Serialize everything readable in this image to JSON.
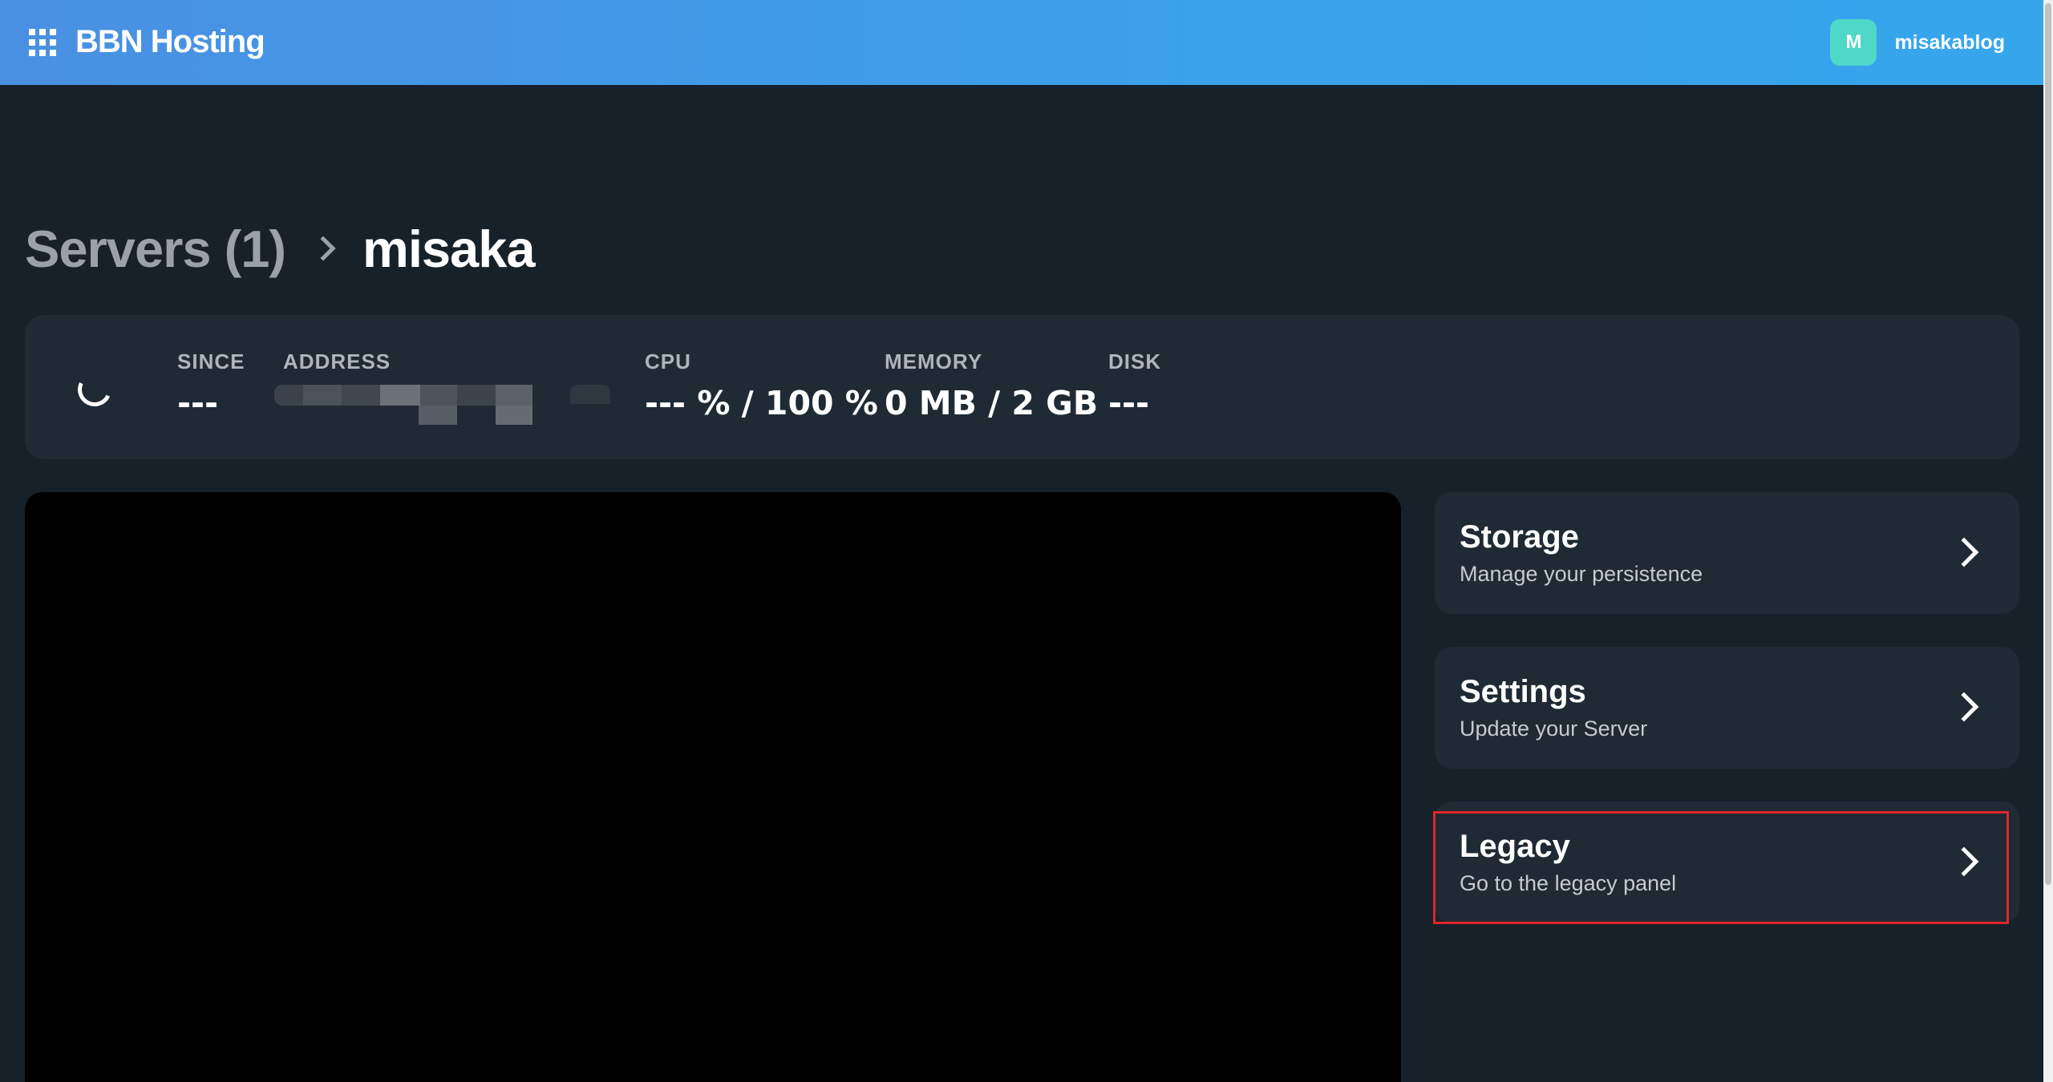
{
  "header": {
    "brand": "BBN Hosting",
    "user": {
      "avatar_letter": "M",
      "username": "misakablog"
    }
  },
  "breadcrumb": {
    "parent": "Servers (1)",
    "current": "misaka"
  },
  "stats": {
    "since": {
      "label": "SINCE",
      "value": "---"
    },
    "address": {
      "label": "ADDRESS",
      "value": ""
    },
    "cpu": {
      "label": "CPU",
      "value": "--- % / 100 %"
    },
    "memory": {
      "label": "MEMORY",
      "value": "0 MB / 2 GB"
    },
    "disk": {
      "label": "DISK",
      "value": "---"
    }
  },
  "cards": [
    {
      "title": "Storage",
      "subtitle": "Manage your persistence"
    },
    {
      "title": "Settings",
      "subtitle": "Update your Server"
    },
    {
      "title": "Legacy",
      "subtitle": "Go to the legacy panel"
    }
  ],
  "colors": {
    "header_gradient_start": "#4a90e2",
    "header_gradient_end": "#35a6ec",
    "background": "#17212a",
    "panel": "#1f2a34",
    "avatar": "#4fd8c7",
    "highlight": "#e0242b"
  },
  "icons": {
    "apps": "grid-icon",
    "breadcrumb_separator": "chevron-right-icon",
    "loading": "spinner-icon",
    "card_arrow": "chevron-right-icon"
  }
}
